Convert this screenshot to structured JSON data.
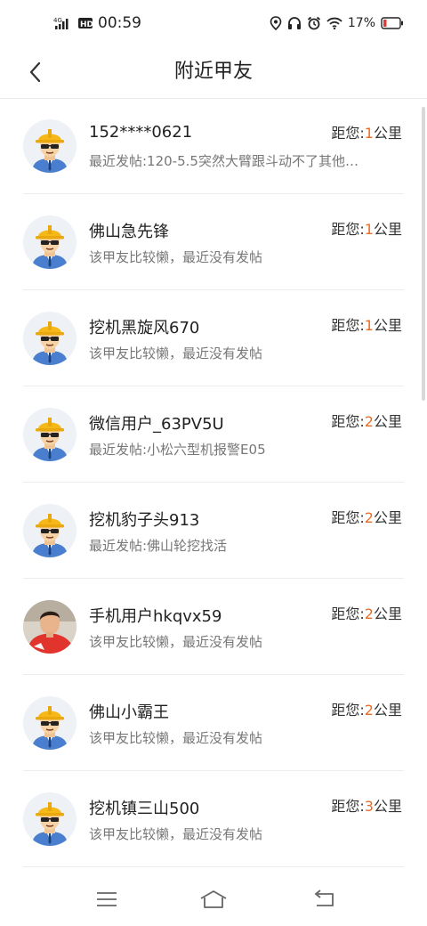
{
  "status_bar": {
    "network": "4G",
    "hd": "HD",
    "time": "00:59",
    "battery": "17%",
    "icons": [
      "location-icon",
      "headset-icon",
      "alarm-icon",
      "wifi-icon",
      "battery-icon"
    ]
  },
  "header": {
    "title": "附近甲友",
    "back_icon": "chevron-left-icon"
  },
  "distance_prefix": "距您:",
  "distance_unit": "公里",
  "accent_color": "#ee6c1e",
  "users": [
    {
      "name": "152****0621",
      "sub": "最近发帖:120-5.5突然大臂跟斗动不了其他…",
      "distance": "1",
      "avatar": "worker-avatar"
    },
    {
      "name": "佛山急先锋",
      "sub": "该甲友比较懒，最近没有发帖",
      "distance": "1",
      "avatar": "worker-avatar"
    },
    {
      "name": "挖机黑旋风670",
      "sub": "该甲友比较懒，最近没有发帖",
      "distance": "1",
      "avatar": "worker-avatar"
    },
    {
      "name": "微信用户_63PV5U",
      "sub": "最近发帖:小松六型机报警E05",
      "distance": "2",
      "avatar": "worker-avatar"
    },
    {
      "name": "挖机豹子头913",
      "sub": "最近发帖:佛山轮挖找活",
      "distance": "2",
      "avatar": "worker-avatar"
    },
    {
      "name": "手机用户hkqvx59",
      "sub": "该甲友比较懒，最近没有发帖",
      "distance": "2",
      "avatar": "photo-avatar"
    },
    {
      "name": "佛山小霸王",
      "sub": "该甲友比较懒，最近没有发帖",
      "distance": "2",
      "avatar": "worker-avatar"
    },
    {
      "name": "挖机镇三山500",
      "sub": "该甲友比较懒，最近没有发帖",
      "distance": "3",
      "avatar": "worker-avatar"
    }
  ],
  "bottom_nav": [
    "menu-icon",
    "home-icon",
    "back-icon"
  ]
}
